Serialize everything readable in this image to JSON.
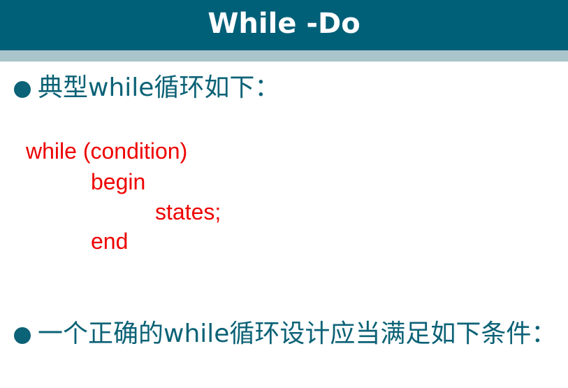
{
  "header": {
    "title": "While -Do"
  },
  "bullets": [
    {
      "text": "典型while循环如下："
    },
    {
      "text": "一个正确的while循环设计应当满足如下条件："
    }
  ],
  "code": {
    "lines": [
      "while (condition)",
      "begin",
      "states;",
      "end"
    ]
  },
  "colors": {
    "header_bg": "#006078",
    "header_strip": "#a9c4cb",
    "bullet_text": "#0c6276",
    "code_text": "#ee0000"
  }
}
